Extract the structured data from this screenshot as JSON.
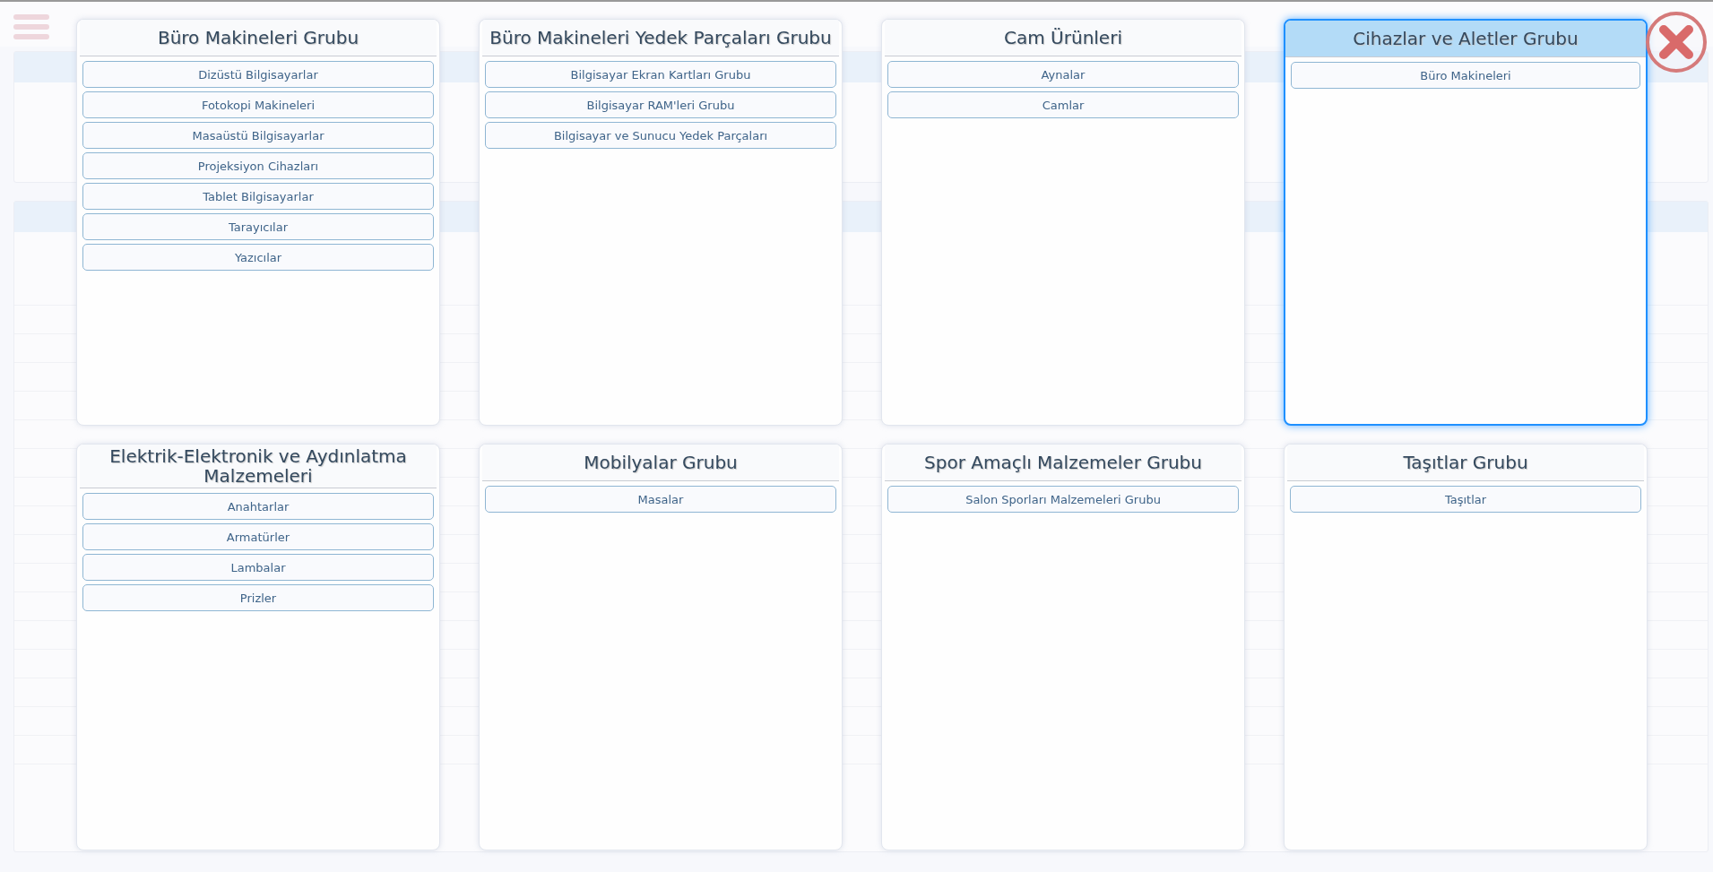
{
  "groups": [
    {
      "title": "Büro Makineleri Grubu",
      "selected": false,
      "items": [
        "Dizüstü Bilgisayarlar",
        "Fotokopi Makineleri",
        "Masaüstü Bilgisayarlar",
        "Projeksiyon Cihazları",
        "Tablet Bilgisayarlar",
        "Tarayıcılar",
        "Yazıcılar"
      ]
    },
    {
      "title": "Büro Makineleri Yedek Parçaları Grubu",
      "selected": false,
      "items": [
        "Bilgisayar Ekran Kartları Grubu",
        "Bilgisayar RAM'leri Grubu",
        "Bilgisayar ve Sunucu Yedek Parçaları"
      ]
    },
    {
      "title": "Cam Ürünleri",
      "selected": false,
      "items": [
        "Aynalar",
        "Camlar"
      ]
    },
    {
      "title": "Cihazlar ve Aletler Grubu",
      "selected": true,
      "items": [
        "Büro Makineleri"
      ]
    },
    {
      "title": "Elektrik-Elektronik ve Aydınlatma Malzemeleri",
      "selected": false,
      "items": [
        "Anahtarlar",
        "Armatürler",
        "Lambalar",
        "Prizler"
      ]
    },
    {
      "title": "Mobilyalar Grubu",
      "selected": false,
      "items": [
        "Masalar"
      ]
    },
    {
      "title": "Spor Amaçlı Malzemeler Grubu",
      "selected": false,
      "items": [
        "Salon Sporları Malzemeleri Grubu"
      ]
    },
    {
      "title": "Taşıtlar Grubu",
      "selected": false,
      "items": [
        "Taşıtlar"
      ]
    }
  ]
}
